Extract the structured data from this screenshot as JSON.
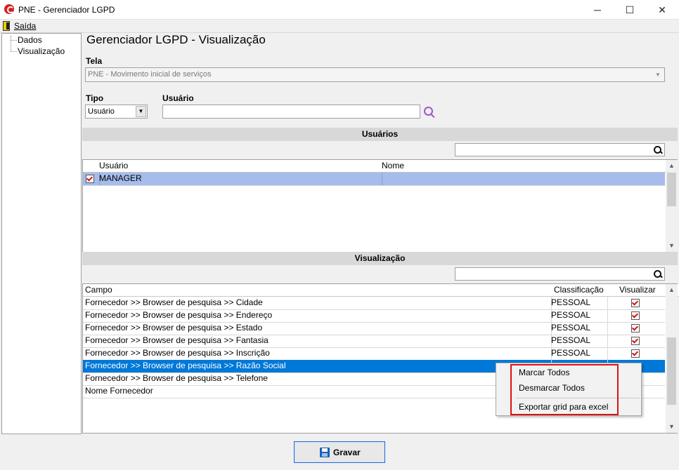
{
  "window": {
    "title": "PNE - Gerenciador LGPD",
    "minimize": "─",
    "maximize": "☐",
    "close": "✕",
    "app_icon": "app-g-icon"
  },
  "menu": {
    "saida": "Saída",
    "saida_icon": "exit-door-icon"
  },
  "tree": {
    "items": [
      "Dados",
      "Visualização"
    ]
  },
  "page": {
    "title": "Gerenciador LGPD - Visualização"
  },
  "tela": {
    "label": "Tela",
    "value": "PNE - Movimento inicial de serviços"
  },
  "tipo": {
    "label": "Tipo",
    "value": "Usuário"
  },
  "usuario": {
    "label": "Usuário",
    "value": "",
    "search_icon": "magnifier-icon"
  },
  "usuarios_section": {
    "title": "Usuários",
    "filter_value": "",
    "columns": [
      "Usuário",
      "Nome"
    ],
    "rows": [
      {
        "checked": true,
        "usuario": "MANAGER",
        "nome": ""
      }
    ]
  },
  "visualizacao_section": {
    "title": "Visualização",
    "filter_value": "",
    "columns": [
      "Campo",
      "Classificação",
      "Visualizar"
    ],
    "rows": [
      {
        "campo": "Fornecedor >> Browser de pesquisa >> Cidade",
        "classificacao": "PESSOAL",
        "visualizar": true
      },
      {
        "campo": "Fornecedor >> Browser de pesquisa >> Endereço",
        "classificacao": "PESSOAL",
        "visualizar": true
      },
      {
        "campo": "Fornecedor >> Browser de pesquisa >> Estado",
        "classificacao": "PESSOAL",
        "visualizar": true
      },
      {
        "campo": "Fornecedor >> Browser de pesquisa >> Fantasia",
        "classificacao": "PESSOAL",
        "visualizar": true
      },
      {
        "campo": "Fornecedor >> Browser de pesquisa >> Inscrição",
        "classificacao": "PESSOAL",
        "visualizar": true
      },
      {
        "campo": "Fornecedor >> Browser de pesquisa >> Razão Social",
        "classificacao": "",
        "visualizar": false
      },
      {
        "campo": "Fornecedor >> Browser de pesquisa >> Telefone",
        "classificacao": "",
        "visualizar": false
      },
      {
        "campo": "Nome Fornecedor",
        "classificacao": "",
        "visualizar": false
      }
    ],
    "selected_row": 5
  },
  "context_menu": {
    "items": [
      "Marcar Todos",
      "Desmarcar Todos",
      "Exportar grid para excel"
    ]
  },
  "footer": {
    "gravar": "Gravar",
    "gravar_icon": "floppy-disk-icon"
  },
  "colors": {
    "selection": "#0078d7",
    "user_row_selection": "#a5bcec",
    "highlight_box": "#e01010",
    "check": "#d01818"
  }
}
